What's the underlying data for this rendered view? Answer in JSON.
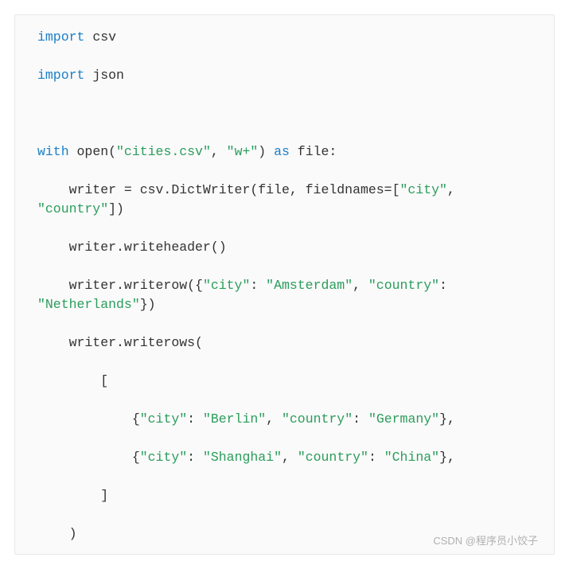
{
  "code": {
    "l1_kw1": "import",
    "l1_t1": " csv",
    "l3_kw1": "import",
    "l3_t1": " json",
    "l7_kw1": "with",
    "l7_t1": " open(",
    "l7_s1": "\"cities.csv\"",
    "l7_t2": ", ",
    "l7_s2": "\"w+\"",
    "l7_t3": ") ",
    "l7_kw2": "as",
    "l7_t4": " file:",
    "l9_t1": "    writer = csv.DictWriter(file, fieldnames=[",
    "l9_s1": "\"city\"",
    "l9_t2": ", ",
    "l10_s1": "\"country\"",
    "l10_t1": "])",
    "l12_t1": "    writer.writeheader()",
    "l14_t1": "    writer.writerow({",
    "l14_s1": "\"city\"",
    "l14_t2": ": ",
    "l14_s2": "\"Amsterdam\"",
    "l14_t3": ", ",
    "l14_s3": "\"country\"",
    "l14_t4": ": ",
    "l15_s1": "\"Netherlands\"",
    "l15_t1": "})",
    "l17_t1": "    writer.writerows(",
    "l19_t1": "        [",
    "l21_t1": "            {",
    "l21_s1": "\"city\"",
    "l21_t2": ": ",
    "l21_s2": "\"Berlin\"",
    "l21_t3": ", ",
    "l21_s3": "\"country\"",
    "l21_t4": ": ",
    "l21_s4": "\"Germany\"",
    "l21_t5": "},",
    "l23_t1": "            {",
    "l23_s1": "\"city\"",
    "l23_t2": ": ",
    "l23_s2": "\"Shanghai\"",
    "l23_t3": ", ",
    "l23_s3": "\"country\"",
    "l23_t4": ": ",
    "l23_s4": "\"China\"",
    "l23_t5": "},",
    "l25_t1": "        ]",
    "l27_t1": "    )"
  },
  "watermark": "CSDN @程序员小饺子"
}
